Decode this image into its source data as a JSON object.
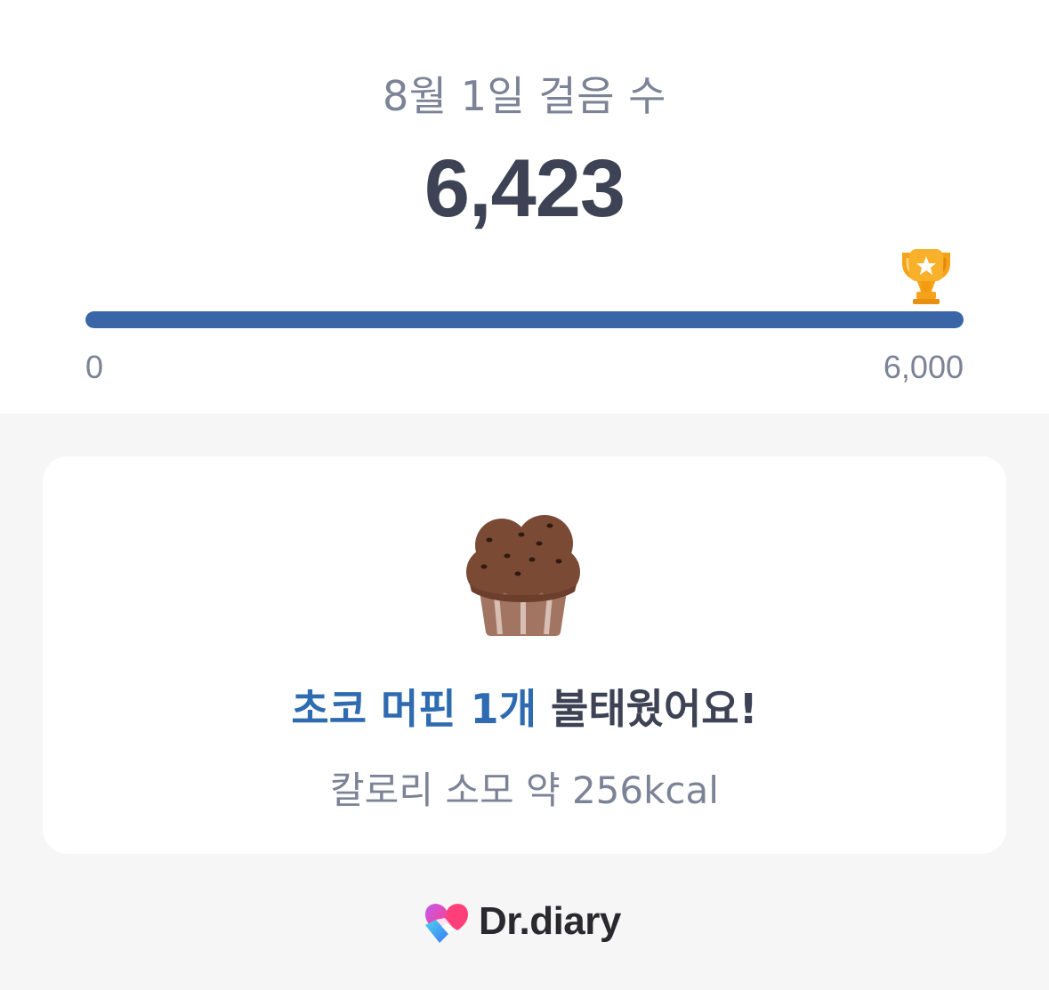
{
  "steps": {
    "title": "8월 1일 걸음 수",
    "count": "6,423",
    "goal_min": "0",
    "goal_max": "6,000",
    "progress_fraction": 1.0
  },
  "burn_card": {
    "food_highlight": "초코 머핀 1개",
    "burn_suffix": " 불태웠어요!",
    "calorie_text": "칼로리 소모 약 256kcal",
    "food_icon": "muffin-icon"
  },
  "brand": {
    "name": "Dr.diary",
    "logo_icon": "heart-logo-icon"
  },
  "colors": {
    "progress_fill": "#3a66a8",
    "highlight": "#2f6bb0",
    "trophy": "#f7a21b"
  }
}
